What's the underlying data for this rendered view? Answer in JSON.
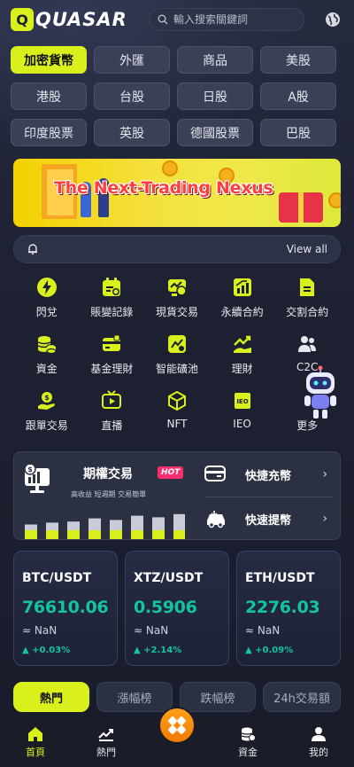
{
  "brand": {
    "mark": "Q",
    "name": "QUASAR"
  },
  "search": {
    "placeholder": "輸入搜索關鍵詞"
  },
  "markets": [
    "加密貨幣",
    "外匯",
    "商品",
    "美股",
    "港股",
    "台股",
    "日股",
    "A股",
    "印度股票",
    "英股",
    "德國股票",
    "巴股"
  ],
  "banner": {
    "title": "The Next-Trading Nexus"
  },
  "notice": {
    "view_all": "View all"
  },
  "features": [
    {
      "label": "閃兌",
      "icon": "lightning-icon"
    },
    {
      "label": "賬變記錄",
      "icon": "record-icon"
    },
    {
      "label": "現貨交易",
      "icon": "spot-trade-icon"
    },
    {
      "label": "永續合約",
      "icon": "perpetual-contract-icon"
    },
    {
      "label": "交割合約",
      "icon": "delivery-contract-icon"
    },
    {
      "label": "資金",
      "icon": "coins-icon"
    },
    {
      "label": "基金理財",
      "icon": "fund-icon"
    },
    {
      "label": "智能礦池",
      "icon": "mining-pool-icon"
    },
    {
      "label": "理財",
      "icon": "wealth-icon"
    },
    {
      "label": "C2C",
      "icon": "users-icon"
    },
    {
      "label": "跟單交易",
      "icon": "copy-trade-icon"
    },
    {
      "label": "直播",
      "icon": "live-icon"
    },
    {
      "label": "NFT",
      "icon": "nft-cube-icon"
    },
    {
      "label": "IEO",
      "icon": "ieo-icon"
    },
    {
      "label": "更多",
      "icon": "more-icon"
    }
  ],
  "options": {
    "title": "期權交易",
    "badge": "HOT",
    "subtitle": "高收益 短週期 交易簡單",
    "bars": [
      0.55,
      0.62,
      0.66,
      0.78,
      0.72,
      0.88,
      0.82,
      0.94
    ]
  },
  "quick": {
    "deposit": "快捷充幣",
    "withdraw": "快速提幣"
  },
  "tickers": [
    {
      "pair": "BTC/USDT",
      "price": "76610.06",
      "nan": "≈ NaN",
      "change": "+0.03%"
    },
    {
      "pair": "XTZ/USDT",
      "price": "0.5906",
      "nan": "≈ NaN",
      "change": "+2.14%"
    },
    {
      "pair": "ETH/USDT",
      "price": "2276.03",
      "nan": "≈ NaN",
      "change": "+0.09%"
    }
  ],
  "rank_tabs": [
    "熱門",
    "漲幅榜",
    "跌幅榜",
    "24h交易額"
  ],
  "nav": [
    {
      "label": "首頁",
      "icon": "home-icon"
    },
    {
      "label": "熱門",
      "icon": "trend-icon"
    },
    {
      "label": "",
      "icon": "center-icon"
    },
    {
      "label": "資金",
      "icon": "coins-icon"
    },
    {
      "label": "我的",
      "icon": "user-icon"
    }
  ],
  "colors": {
    "accent": "#d9f01d",
    "up": "#13c4a3",
    "hot": "#ff2e6e"
  }
}
